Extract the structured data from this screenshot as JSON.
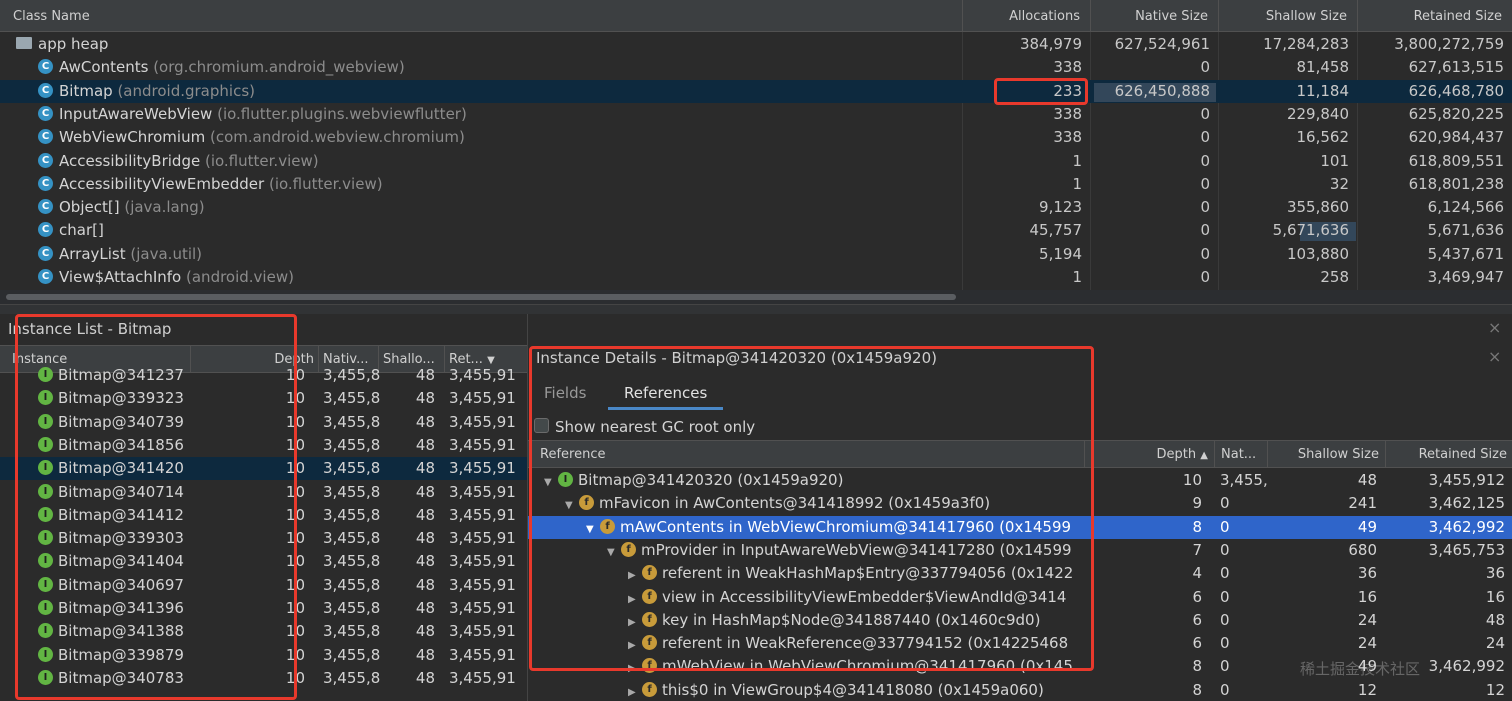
{
  "class_table": {
    "headers": {
      "class_name": "Class Name",
      "allocations": "Allocations",
      "native_size": "Native Size",
      "shallow_size": "Shallow Size",
      "retained_size": "Retained Size"
    },
    "root": {
      "name": "app heap",
      "allocations": "384,979",
      "native": "627,524,961",
      "shallow": "17,284,283",
      "retained": "3,800,272,759"
    },
    "rows": [
      {
        "name": "AwContents",
        "pkg": "(org.chromium.android_webview)",
        "allocations": "338",
        "native": "0",
        "shallow": "81,458",
        "retained": "627,613,515"
      },
      {
        "name": "Bitmap",
        "pkg": "(android.graphics)",
        "allocations": "233",
        "native": "626,450,888",
        "shallow": "11,184",
        "retained": "626,468,780"
      },
      {
        "name": "InputAwareWebView",
        "pkg": "(io.flutter.plugins.webviewflutter)",
        "allocations": "338",
        "native": "0",
        "shallow": "229,840",
        "retained": "625,820,225"
      },
      {
        "name": "WebViewChromium",
        "pkg": "(com.android.webview.chromium)",
        "allocations": "338",
        "native": "0",
        "shallow": "16,562",
        "retained": "620,984,437"
      },
      {
        "name": "AccessibilityBridge",
        "pkg": "(io.flutter.view)",
        "allocations": "1",
        "native": "0",
        "shallow": "101",
        "retained": "618,809,551"
      },
      {
        "name": "AccessibilityViewEmbedder",
        "pkg": "(io.flutter.view)",
        "allocations": "1",
        "native": "0",
        "shallow": "32",
        "retained": "618,801,238"
      },
      {
        "name": "Object[]",
        "pkg": "(java.lang)",
        "allocations": "9,123",
        "native": "0",
        "shallow": "355,860",
        "retained": "6,124,566"
      },
      {
        "name": "char[]",
        "pkg": "",
        "allocations": "45,757",
        "native": "0",
        "shallow": "5,671,636",
        "retained": "5,671,636"
      },
      {
        "name": "ArrayList",
        "pkg": "(java.util)",
        "allocations": "5,194",
        "native": "0",
        "shallow": "103,880",
        "retained": "5,437,671"
      },
      {
        "name": "View$AttachInfo",
        "pkg": "(android.view)",
        "allocations": "1",
        "native": "0",
        "shallow": "258",
        "retained": "3,469,947"
      }
    ]
  },
  "instance_list": {
    "title": "Instance List - Bitmap",
    "headers": {
      "instance": "Instance",
      "depth": "Depth",
      "native": "Nativ...",
      "shallow": "Shallo...",
      "retained": "Ret..."
    },
    "rows": [
      {
        "name": "Bitmap@341237",
        "depth": "10",
        "native": "3,455,8",
        "shallow": "48",
        "retained": "3,455,91"
      },
      {
        "name": "Bitmap@339323",
        "depth": "10",
        "native": "3,455,8",
        "shallow": "48",
        "retained": "3,455,91"
      },
      {
        "name": "Bitmap@340739",
        "depth": "10",
        "native": "3,455,8",
        "shallow": "48",
        "retained": "3,455,91"
      },
      {
        "name": "Bitmap@341856",
        "depth": "10",
        "native": "3,455,8",
        "shallow": "48",
        "retained": "3,455,91"
      },
      {
        "name": "Bitmap@341420",
        "depth": "10",
        "native": "3,455,8",
        "shallow": "48",
        "retained": "3,455,91"
      },
      {
        "name": "Bitmap@340714",
        "depth": "10",
        "native": "3,455,8",
        "shallow": "48",
        "retained": "3,455,91"
      },
      {
        "name": "Bitmap@341412",
        "depth": "10",
        "native": "3,455,8",
        "shallow": "48",
        "retained": "3,455,91"
      },
      {
        "name": "Bitmap@339303",
        "depth": "10",
        "native": "3,455,8",
        "shallow": "48",
        "retained": "3,455,91"
      },
      {
        "name": "Bitmap@341404",
        "depth": "10",
        "native": "3,455,8",
        "shallow": "48",
        "retained": "3,455,91"
      },
      {
        "name": "Bitmap@340697",
        "depth": "10",
        "native": "3,455,8",
        "shallow": "48",
        "retained": "3,455,91"
      },
      {
        "name": "Bitmap@341396",
        "depth": "10",
        "native": "3,455,8",
        "shallow": "48",
        "retained": "3,455,91"
      },
      {
        "name": "Bitmap@341388",
        "depth": "10",
        "native": "3,455,8",
        "shallow": "48",
        "retained": "3,455,91"
      },
      {
        "name": "Bitmap@339879",
        "depth": "10",
        "native": "3,455,8",
        "shallow": "48",
        "retained": "3,455,91"
      },
      {
        "name": "Bitmap@340783",
        "depth": "10",
        "native": "3,455,8",
        "shallow": "48",
        "retained": "3,455,91"
      }
    ]
  },
  "instance_details": {
    "title": "Instance Details - Bitmap@341420320 (0x1459a920)",
    "tabs": [
      "Fields",
      "References"
    ],
    "checkbox_label": "Show nearest GC root only",
    "headers": {
      "reference": "Reference",
      "depth": "Depth",
      "native": "Nat...",
      "shallow": "Shallow Size",
      "retained": "Retained Size"
    },
    "rows": [
      {
        "indent": 0,
        "tri": "▼",
        "icon": "I",
        "text": "Bitmap@341420320 (0x1459a920)",
        "depth": "10",
        "native": "3,455,",
        "shallow": "48",
        "retained": "3,455,912"
      },
      {
        "indent": 1,
        "tri": "▼",
        "icon": "f",
        "text": "mFavicon in AwContents@341418992 (0x1459a3f0)",
        "depth": "9",
        "native": "0",
        "shallow": "241",
        "retained": "3,462,125"
      },
      {
        "indent": 2,
        "tri": "▼",
        "icon": "f",
        "text": "mAwContents in WebViewChromium@341417960 (0x14599",
        "depth": "8",
        "native": "0",
        "shallow": "49",
        "retained": "3,462,992"
      },
      {
        "indent": 3,
        "tri": "▼",
        "icon": "f",
        "text": "mProvider in InputAwareWebView@341417280 (0x14599",
        "depth": "7",
        "native": "0",
        "shallow": "680",
        "retained": "3,465,753"
      },
      {
        "indent": 4,
        "tri": "▶",
        "icon": "f",
        "text": "referent in WeakHashMap$Entry@337794056 (0x1422",
        "depth": "4",
        "native": "0",
        "shallow": "36",
        "retained": "36"
      },
      {
        "indent": 4,
        "tri": "▶",
        "icon": "f",
        "text": "view in AccessibilityViewEmbedder$ViewAndId@3414",
        "depth": "6",
        "native": "0",
        "shallow": "16",
        "retained": "16"
      },
      {
        "indent": 4,
        "tri": "▶",
        "icon": "f",
        "text": "key in HashMap$Node@341887440 (0x1460c9d0)",
        "depth": "6",
        "native": "0",
        "shallow": "24",
        "retained": "48"
      },
      {
        "indent": 4,
        "tri": "▶",
        "icon": "f",
        "text": "referent in WeakReference@337794152 (0x14225468",
        "depth": "6",
        "native": "0",
        "shallow": "24",
        "retained": "24"
      },
      {
        "indent": 4,
        "tri": "▶",
        "icon": "f",
        "text": "mWebView in WebViewChromium@341417960 (0x145",
        "depth": "8",
        "native": "0",
        "shallow": "49",
        "retained": "3,462,992"
      },
      {
        "indent": 4,
        "tri": "▶",
        "icon": "f",
        "text": "this$0 in ViewGroup$4@341418080 (0x1459a060)",
        "depth": "8",
        "native": "0",
        "shallow": "12",
        "retained": "12"
      }
    ]
  },
  "icons": {
    "class": "C",
    "instance": "I",
    "field": "f",
    "close": "×",
    "sort_desc": "▼",
    "sort_asc": "▲"
  },
  "watermark": "稀土掘金技术社区",
  "colors": {
    "accent_selected": "#2f65ca",
    "highlight_box": "#e8392c",
    "class_icon": "#3592c4",
    "instance_icon": "#62b543",
    "field_icon": "#c89b3a"
  }
}
